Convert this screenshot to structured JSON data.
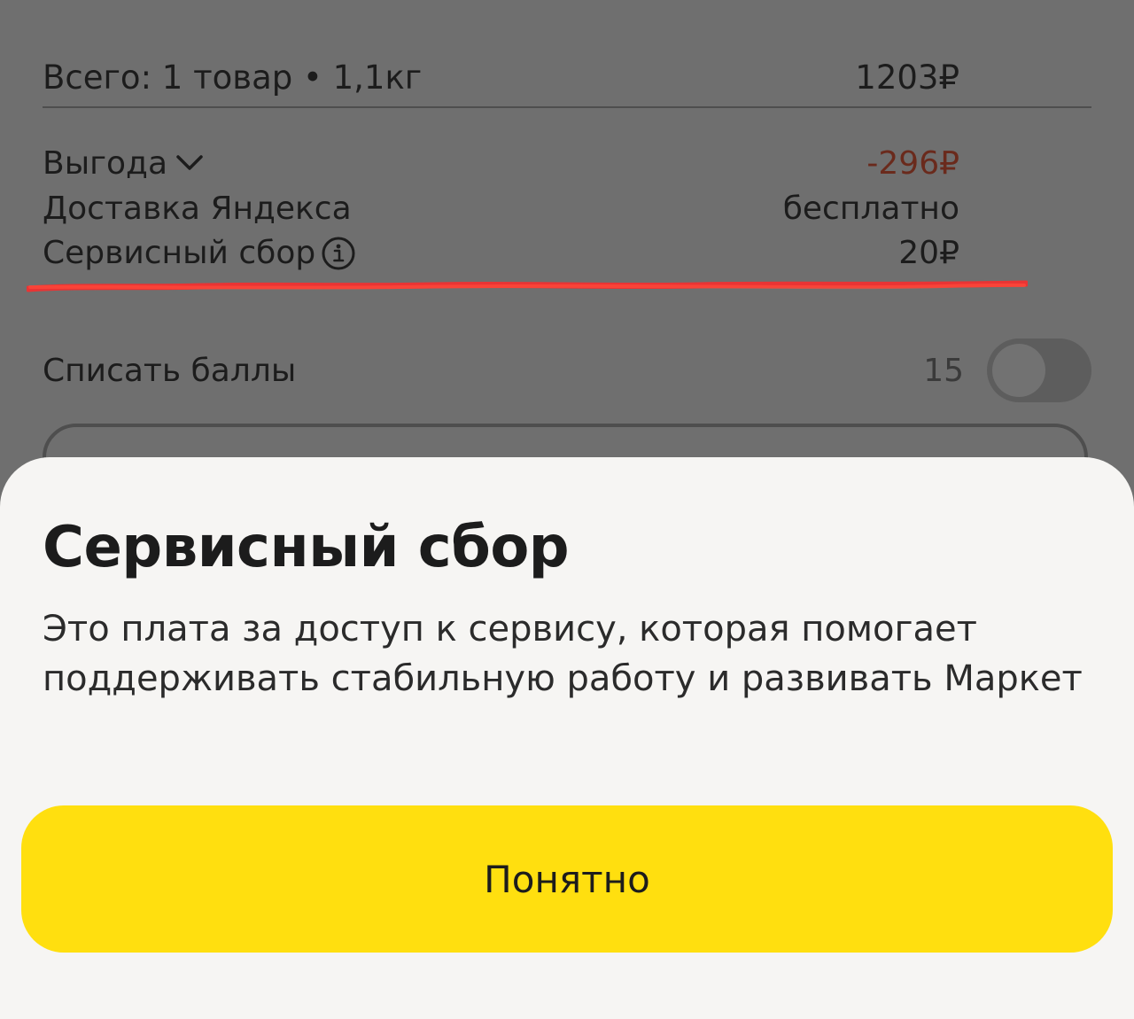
{
  "summary": {
    "total_label": "Всего: 1 товар • 1,1кг",
    "total_value": "1203₽",
    "benefit_label": "Выгода",
    "benefit_value": "-296₽",
    "delivery_label": "Доставка Яндекса",
    "delivery_value": "бесплатно",
    "fee_label": "Сервисный сбор",
    "fee_value": "20₽",
    "points_label": "Списать баллы",
    "points_value": "15",
    "points_toggle_on": false
  },
  "icons": {
    "benefit_expand": "chevron-down-icon",
    "fee_info": "info-icon"
  },
  "sheet": {
    "title": "Сервисный сбор",
    "description": "Это плата за доступ к сервису, которая помогает поддерживать стабильную работу и развивать Маркет",
    "button_label": "Понятно"
  },
  "colors": {
    "accent_button": "#ffdf0f",
    "benefit_value": "#6a2a1c",
    "annotation_underline": "#ff2a2a",
    "overlay_dim": "#6f6f6f",
    "sheet_background": "#f6f5f3"
  }
}
